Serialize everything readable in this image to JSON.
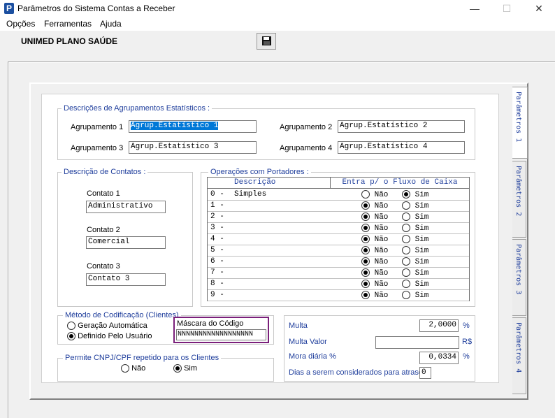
{
  "window": {
    "title": "Parâmetros do Sistema Contas a Receber",
    "icon_letter": "P"
  },
  "menu": [
    "Opções",
    "Ferramentas",
    "Ajuda"
  ],
  "header": {
    "company": "UNIMED PLANO SAÚDE"
  },
  "agrupamentos": {
    "legend": "Descrições de Agrupamentos Estatísticos :",
    "items": [
      {
        "label": "Agrupamento 1",
        "value": "Agrup.Estatístico 1"
      },
      {
        "label": "Agrupamento 2",
        "value": "Agrup.Estatístico 2"
      },
      {
        "label": "Agrupamento 3",
        "value": "Agrup.Estatístico 3"
      },
      {
        "label": "Agrupamento 4",
        "value": "Agrup.Estatístico 4"
      }
    ]
  },
  "contatos": {
    "legend": "Descrição de Contatos :",
    "items": [
      {
        "label": "Contato 1",
        "value": "Administrativo"
      },
      {
        "label": "Contato 2",
        "value": "Comercial"
      },
      {
        "label": "Contato 3",
        "value": "Contato 3"
      }
    ]
  },
  "portadores": {
    "legend": "Operações com Portadores :",
    "col_desc": "Descrição",
    "col_fluxo": "Entra p/ o Fluxo de Caixa",
    "opt_nao": "Não",
    "opt_sim": "Sim",
    "rows": [
      {
        "code": "0 -",
        "desc": "Simples",
        "value": "Sim"
      },
      {
        "code": "1 -",
        "desc": "",
        "value": "Não"
      },
      {
        "code": "2 -",
        "desc": "",
        "value": "Não"
      },
      {
        "code": "3 -",
        "desc": "",
        "value": "Não"
      },
      {
        "code": "4 -",
        "desc": "",
        "value": "Não"
      },
      {
        "code": "5 -",
        "desc": "",
        "value": "Não"
      },
      {
        "code": "6 -",
        "desc": "",
        "value": "Não"
      },
      {
        "code": "7 -",
        "desc": "",
        "value": "Não"
      },
      {
        "code": "8 -",
        "desc": "",
        "value": "Não"
      },
      {
        "code": "9 -",
        "desc": "",
        "value": "Não"
      }
    ]
  },
  "codificacao": {
    "legend": "Método de Codificação (Clientes)",
    "opt_auto": "Geração Automática",
    "opt_user": "Definido Pelo Usuário",
    "selected": "Definido Pelo Usuário",
    "mask_label": "Máscara do Código",
    "mask_value": "NNNNNNNNNNNNNNNNNN"
  },
  "cnpj": {
    "legend": "Permite CNPJ/CPF repetido para os Clientes",
    "opt_nao": "Não",
    "opt_sim": "Sim",
    "selected": "Sim"
  },
  "financeiro": {
    "multa_label": "Multa",
    "multa_value": "2,0000",
    "multa_unit": "%",
    "multa_valor_label": "Multa Valor",
    "multa_valor_value": "",
    "multa_valor_unit": "R$",
    "mora_label": "Mora diária %",
    "mora_value": "0,0334",
    "mora_unit": "%",
    "dias_label": "Dias a serem considerados para atraso",
    "dias_value": "0"
  },
  "tabs": [
    {
      "label": "Parâmetros 1",
      "active": true
    },
    {
      "label": "Parâmetros 2",
      "active": false
    },
    {
      "label": "Parâmetros 3",
      "active": false
    },
    {
      "label": "Parâmetros 4",
      "active": false
    }
  ],
  "colors": {
    "legend": "#1f3e9c",
    "selection": "#0078d7",
    "mask_border": "#7a1f7a"
  }
}
